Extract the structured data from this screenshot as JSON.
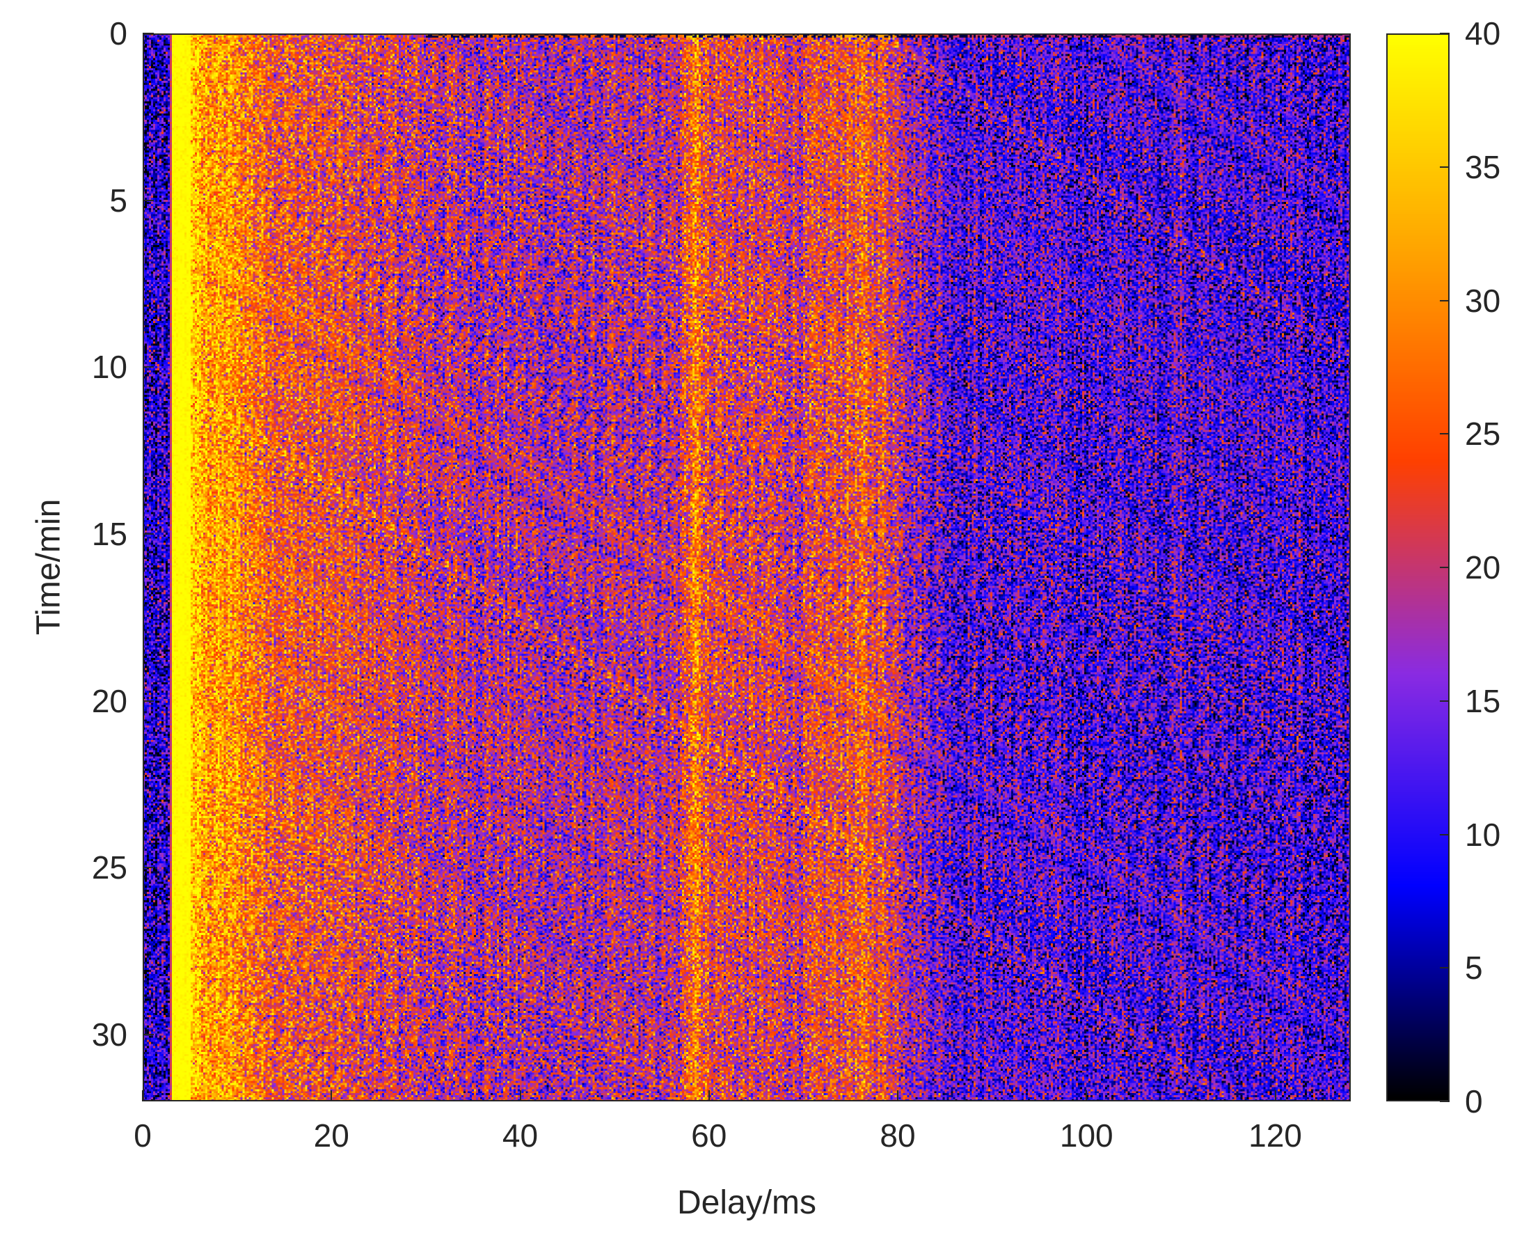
{
  "chart_data": {
    "type": "heatmap",
    "title": "",
    "xlabel": "Delay/ms",
    "ylabel": "Time/min",
    "xlim": [
      0,
      128
    ],
    "ylim": [
      0,
      32
    ],
    "y_reversed": true,
    "clim": [
      0,
      40
    ],
    "xticks": [
      "0",
      "20",
      "40",
      "60",
      "80",
      "100",
      "120"
    ],
    "yticks": [
      "0",
      "5",
      "10",
      "15",
      "20",
      "25",
      "30"
    ],
    "colorbar_ticks": [
      "0",
      "5",
      "10",
      "15",
      "20",
      "25",
      "30",
      "35",
      "40"
    ],
    "colormap": [
      "#000000",
      "#0000ff",
      "#8a2be2",
      "#ff4000",
      "#ffa500",
      "#ffff00"
    ],
    "mean_intensity_profile": {
      "delay_ms": [
        0,
        2.9,
        3.1,
        5,
        6,
        9,
        12,
        15,
        25,
        30,
        45,
        57,
        58.5,
        59.5,
        62,
        70,
        74,
        76,
        79,
        82,
        86,
        100,
        109,
        110,
        111,
        128
      ],
      "value": [
        8,
        8,
        40,
        40,
        33,
        31,
        28,
        25,
        22,
        20,
        18,
        19,
        32,
        24,
        22,
        21,
        24,
        25,
        23,
        17,
        13,
        12,
        12,
        16,
        12,
        11
      ]
    }
  }
}
